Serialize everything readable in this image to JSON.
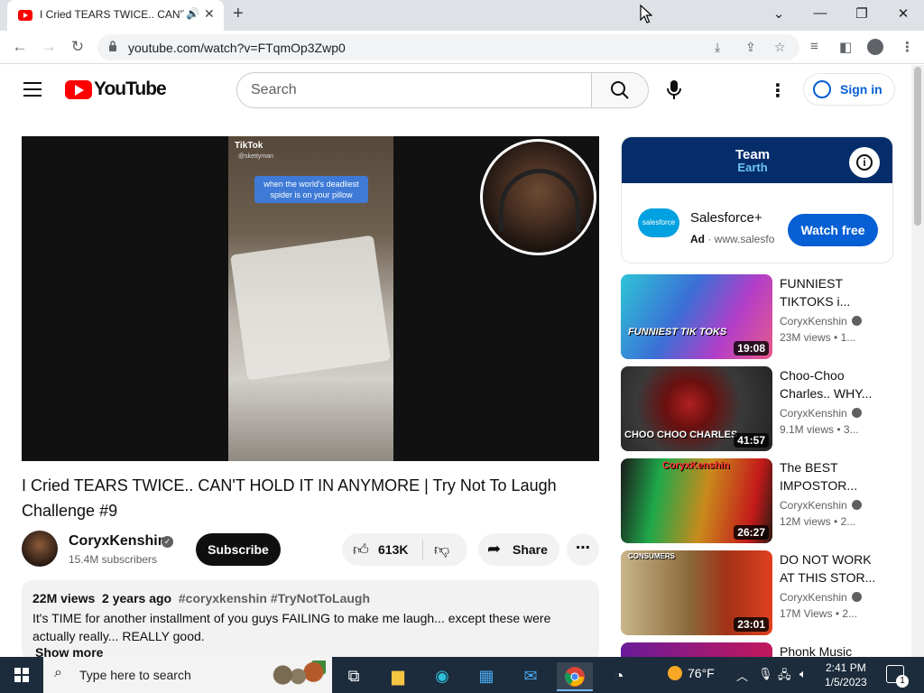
{
  "browser": {
    "tab_title": "I Cried TEARS TWICE.. CAN'T",
    "new_tab_symbol": "+",
    "url": "youtube.com/watch?v=FTqmOp3Zwp0",
    "window_controls": {
      "dropdown": "⌄",
      "minimize": "—",
      "restore": "❐",
      "close": "✕"
    }
  },
  "youtube": {
    "logo_text": "YouTube",
    "search_placeholder": "Search",
    "sign_in": "Sign in"
  },
  "video": {
    "overlay_app": "TikTok",
    "overlay_user": "@skettyman",
    "overlay_caption": "when the world's deadliest spider is on your pillow",
    "title": "I Cried TEARS TWICE.. CAN'T HOLD IT IN ANYMORE | Try Not To Laugh Challenge #9",
    "channel": "CoryxKenshin",
    "subscribers": "15.4M subscribers",
    "subscribe_label": "Subscribe",
    "likes": "613K",
    "share_label": "Share",
    "views": "22M views",
    "age": "2 years ago",
    "tags": "#coryxkenshin #TryNotToLaugh",
    "description": "It's TIME for another installment of you guys FAILING to make me laugh... except these were actually really... REALLY good.",
    "show_more": "Show more"
  },
  "ad": {
    "banner_text_1": "Team",
    "banner_text_2": "Earth",
    "brand_logo_text": "salesforce",
    "title": "Salesforce+",
    "ad_label": "Ad",
    "domain": "www.salesfo",
    "cta": "Watch free"
  },
  "recommendations": [
    {
      "title": "FUNNIEST TIKTOKS i...",
      "channel": "CoryxKenshin",
      "views": "23M views",
      "age": "1...",
      "duration": "19:08",
      "thumb_text": "FUNNIEST TIK TOKS",
      "colors": [
        "#2ec4d6",
        "#b23ec8"
      ]
    },
    {
      "title": "Choo-Choo Charles.. WHY...",
      "channel": "CoryxKenshin",
      "views": "9.1M views",
      "age": "3...",
      "duration": "41:57",
      "thumb_text": "CHOO CHOO CHARLES",
      "colors": [
        "#3a3a3a",
        "#8a1414"
      ]
    },
    {
      "title": "The BEST IMPOSTOR...",
      "channel": "CoryxKenshin",
      "views": "12M views",
      "age": "2...",
      "duration": "26:27",
      "thumb_text": "CoryxKenshin",
      "colors": [
        "#1fa84a",
        "#c41a1a"
      ]
    },
    {
      "title": "DO NOT WORK AT THIS STOR...",
      "channel": "CoryxKenshin",
      "views": "17M Views",
      "age": "2...",
      "duration": "23:01",
      "thumb_text": "CONSUMERS",
      "colors": [
        "#c9b58a",
        "#a33218"
      ]
    },
    {
      "title": "Phonk Music",
      "channel": "",
      "views": "",
      "age": "",
      "duration": "",
      "thumb_text": "",
      "colors": [
        "#6a1b9a",
        "#c2185b"
      ]
    }
  ],
  "taskbar": {
    "search_placeholder": "Type here to search",
    "weather": "76°F",
    "time": "2:41 PM",
    "date": "1/5/2023",
    "notification_count": "1"
  }
}
